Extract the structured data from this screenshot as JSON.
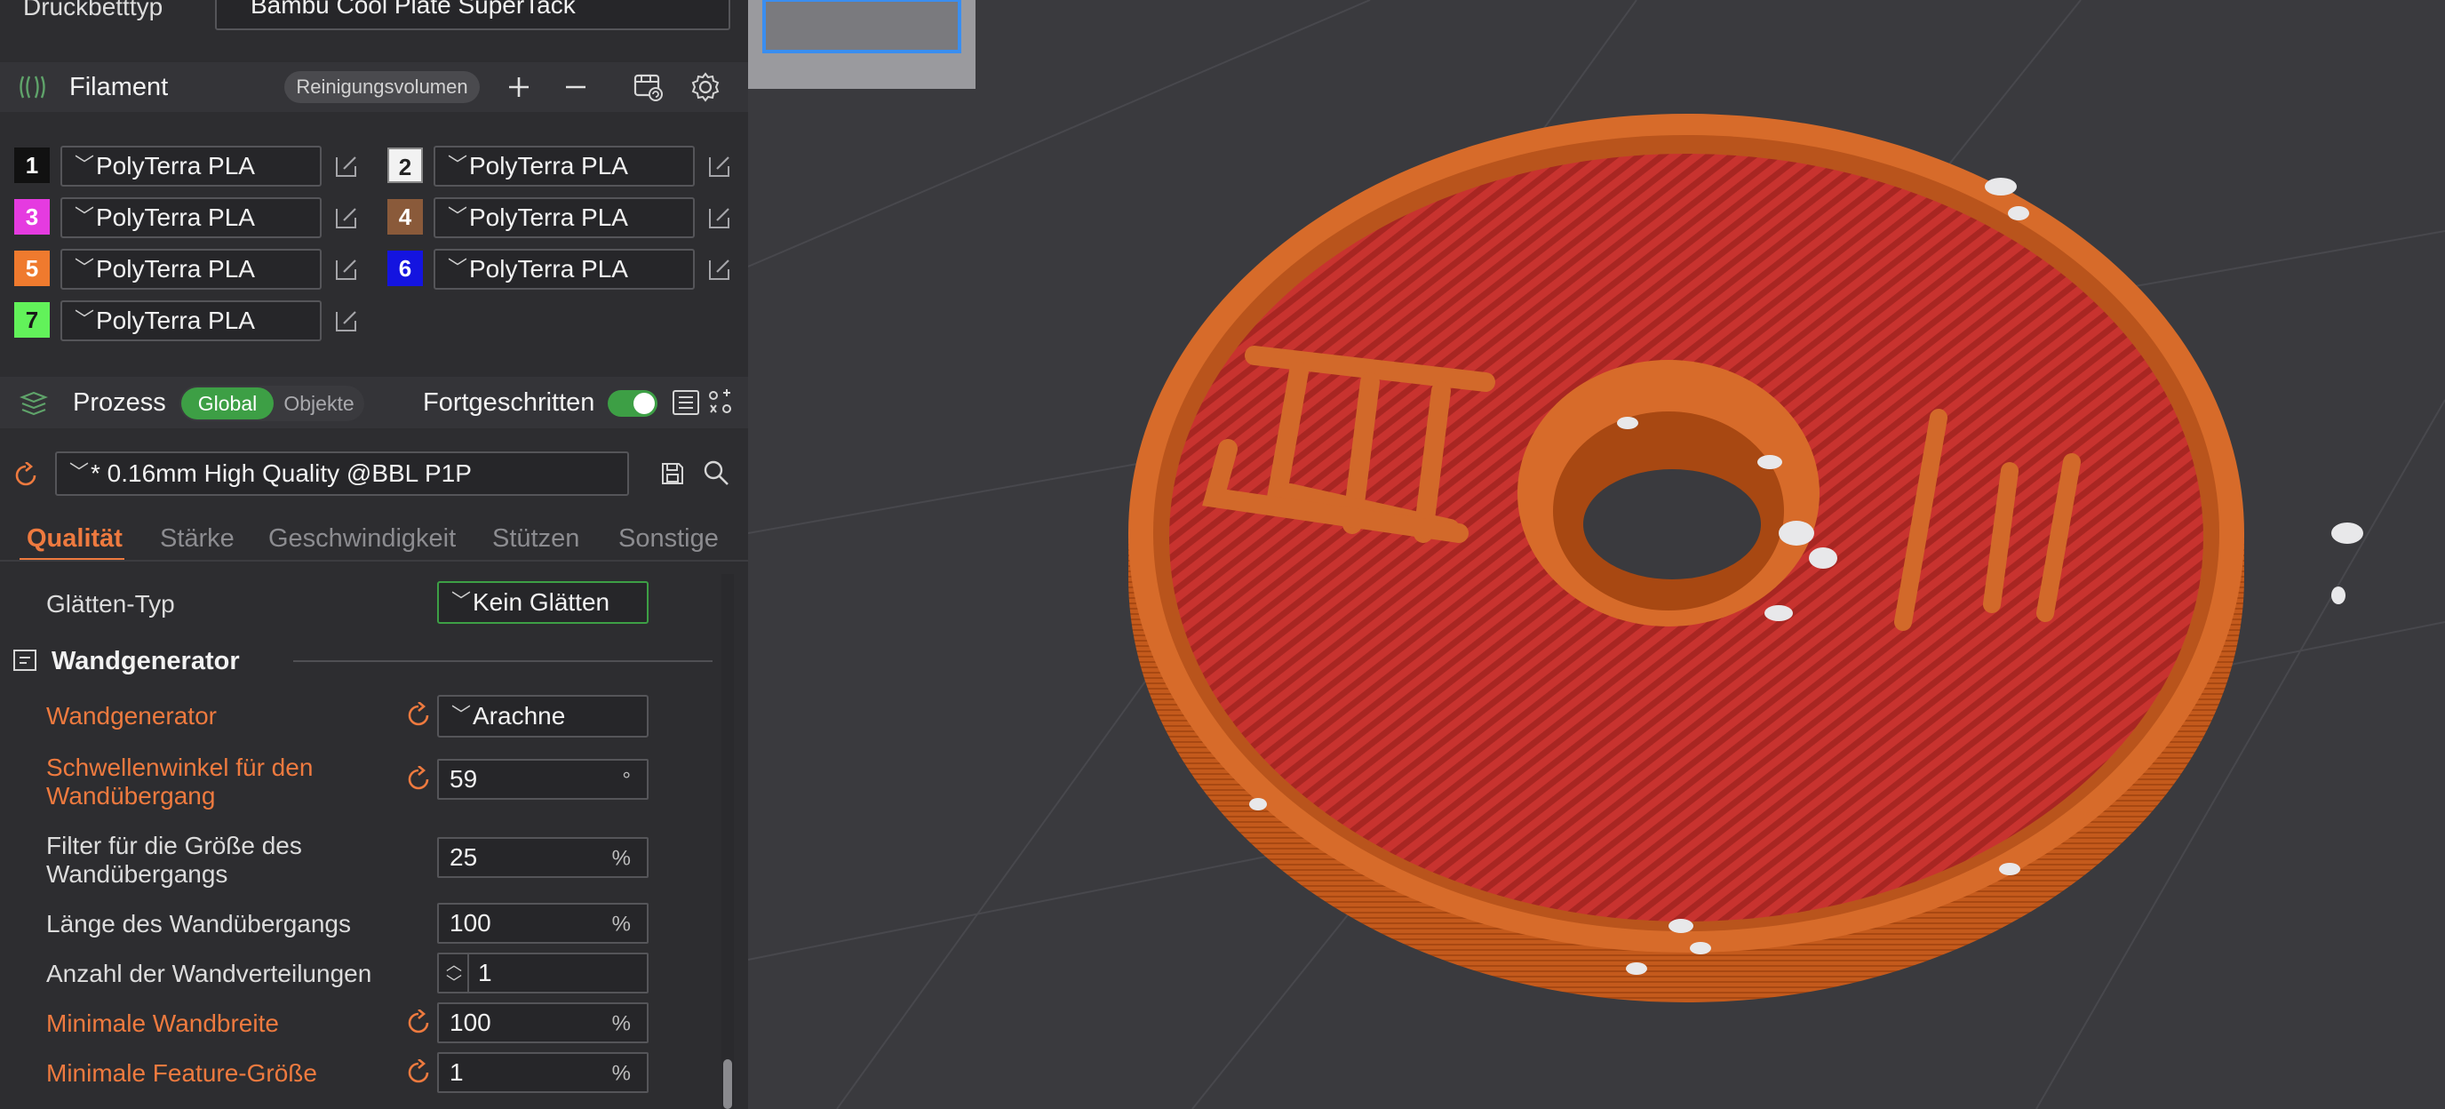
{
  "printer": {
    "bed_label": "Druckbetttyp",
    "bed_value": "Bambu Cool Plate SuperTack"
  },
  "filament": {
    "title": "Filament",
    "purge_button": "Reinigungsvolumen",
    "slots": [
      {
        "num": "1",
        "name": "PolyTerra PLA",
        "color": "#111111",
        "text": "#ffffff"
      },
      {
        "num": "2",
        "name": "PolyTerra PLA",
        "color": "#f2f2f2",
        "text": "#222222"
      },
      {
        "num": "3",
        "name": "PolyTerra PLA",
        "color": "#e53be0",
        "text": "#ffffff"
      },
      {
        "num": "4",
        "name": "PolyTerra PLA",
        "color": "#8a5a3a",
        "text": "#ffffff"
      },
      {
        "num": "5",
        "name": "PolyTerra PLA",
        "color": "#ef7a2e",
        "text": "#ffffff"
      },
      {
        "num": "6",
        "name": "PolyTerra PLA",
        "color": "#1414e0",
        "text": "#ffffff"
      },
      {
        "num": "7",
        "name": "PolyTerra PLA",
        "color": "#62f25a",
        "text": "#1a1a1a"
      }
    ]
  },
  "process": {
    "title": "Prozess",
    "seg_global": "Global",
    "seg_objects": "Objekte",
    "advanced_label": "Fortgeschritten",
    "preset": "* 0.16mm High Quality @BBL P1P",
    "tabs": [
      "Qualität",
      "Stärke",
      "Geschwindigkeit",
      "Stützen",
      "Sonstige"
    ],
    "ironing": {
      "label": "Glätten-Typ",
      "value": "Kein Glätten"
    },
    "section_title": "Wandgenerator",
    "settings": [
      {
        "label": "Wandgenerator",
        "value": "Arachne",
        "unit": "",
        "modified": true,
        "kind": "dropdown"
      },
      {
        "label_l1": "Schwellenwinkel für den",
        "label_l2": "Wandübergang",
        "value": "59",
        "unit": "°",
        "modified": true
      },
      {
        "label_l1": "Filter für die Größe des",
        "label_l2": "Wandübergangs",
        "value": "25",
        "unit": "%",
        "modified": false
      },
      {
        "label": "Länge des Wandübergangs",
        "value": "100",
        "unit": "%",
        "modified": false
      },
      {
        "label": "Anzahl der Wandverteilungen",
        "value": "1",
        "unit": "",
        "modified": false,
        "kind": "spinner"
      },
      {
        "label": "Minimale Wandbreite",
        "value": "100",
        "unit": "%",
        "modified": true
      },
      {
        "label": "Minimale Feature-Größe",
        "value": "1",
        "unit": "%",
        "modified": true
      }
    ]
  },
  "colors": {
    "accent": "#ee7a3f",
    "green": "#3a9c3a",
    "panel": "#2d2d30",
    "viewport": "#3a3a3e"
  }
}
